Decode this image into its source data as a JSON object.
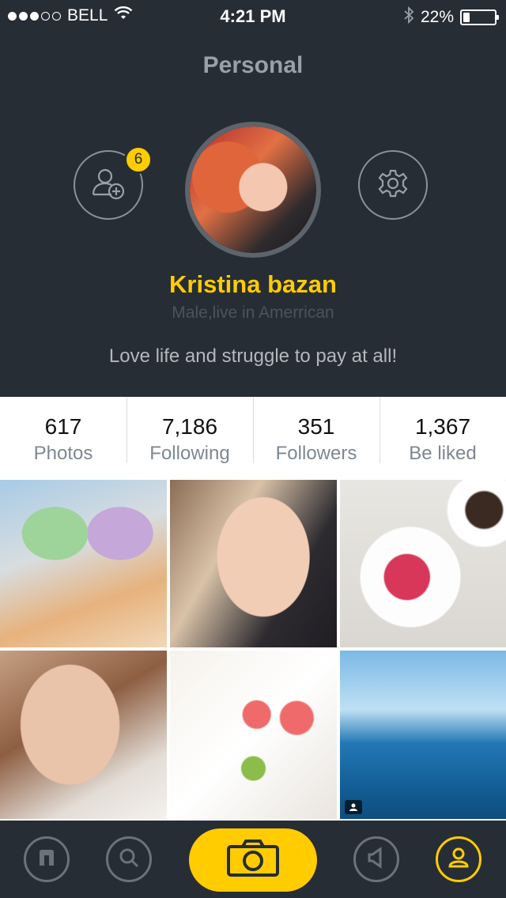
{
  "status_bar": {
    "carrier": "BELL",
    "time": "4:21 PM",
    "battery_percent": "22%",
    "battery_level": 0.22,
    "signal_bars_filled": 3,
    "signal_bars_total": 5,
    "icons": [
      "wifi-icon",
      "bluetooth-icon",
      "battery-icon"
    ]
  },
  "header": {
    "title": "Personal",
    "friend_requests_badge": "6",
    "user_name": "Kristina bazan",
    "user_info": "Male,live in Amerrican",
    "motto": "Love life and struggle to pay at all!",
    "icons": [
      "add-friend-icon",
      "settings-icon"
    ]
  },
  "stats": [
    {
      "value": "617",
      "label": "Photos"
    },
    {
      "value": "7,186",
      "label": "Following"
    },
    {
      "value": "351",
      "label": "Followers"
    },
    {
      "value": "1,367",
      "label": "Be liked"
    }
  ],
  "photos": [
    "ice-cream-photo",
    "portrait-smile-photo",
    "breakfast-fruit-photo",
    "portrait-makeup-photo",
    "dessert-plate-photo",
    "seaside-balcony-photo"
  ],
  "tab_bar": {
    "icons": [
      "home-icon",
      "search-icon",
      "camera-icon",
      "voice-icon",
      "profile-icon"
    ],
    "active_tab": "profile"
  },
  "colors": {
    "background_dark": "#272d35",
    "accent": "#ffcc00",
    "muted_text": "#9aa0a8",
    "stat_label": "#7e8791"
  }
}
